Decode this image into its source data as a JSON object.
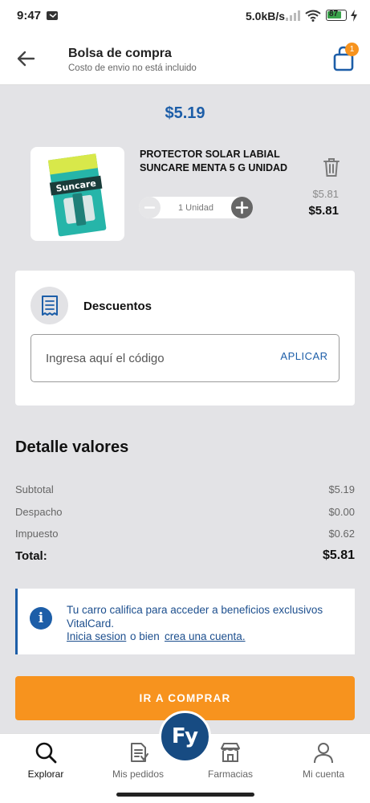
{
  "status_bar": {
    "time": "9:47",
    "speed": "5.0kB/s",
    "battery": "87"
  },
  "header": {
    "title": "Bolsa de compra",
    "subtitle": "Costo de envio no está incluido",
    "back_icon": "arrow-left-icon",
    "cart_icon": "shopping-bag-icon",
    "cart_badge": "1"
  },
  "cart_total": "$5.19",
  "product": {
    "name": "PROTECTOR SOLAR LABIAL SUNCARE MENTA 5 G UNIDAD",
    "image_brand": "Suncare",
    "quantity_label": "1 Unidad",
    "price_old": "$5.81",
    "price_new": "$5.81"
  },
  "discounts": {
    "title": "Descuentos",
    "placeholder": "Ingresa aquí el código",
    "apply_label": "APLICAR"
  },
  "details": {
    "title": "Detalle valores",
    "rows": [
      {
        "label": "Subtotal",
        "value": "$5.19"
      },
      {
        "label": "Despacho",
        "value": "$0.00"
      },
      {
        "label": "Impuesto",
        "value": "$0.62"
      }
    ],
    "total_label": "Total:",
    "total_value": "$5.81"
  },
  "info": {
    "text": "Tu carro califica para acceder a beneficios exclusivos VitalCard.",
    "login_link": "Inicia sesion",
    "middle": "o bien",
    "signup_link": "crea una cuenta."
  },
  "buy_button": "IR A COMPRAR",
  "bottom_nav": {
    "items": [
      {
        "label": "Explorar",
        "icon": "search-icon"
      },
      {
        "label": "Mis pedidos",
        "icon": "orders-icon"
      },
      {
        "label": "Farmacias",
        "icon": "store-icon"
      },
      {
        "label": "Mi cuenta",
        "icon": "user-icon"
      }
    ],
    "fab_text": "Fy"
  },
  "colors": {
    "brand_blue": "#1d5ea8",
    "accent_orange": "#f7931e",
    "background": "#e3e3e6"
  }
}
